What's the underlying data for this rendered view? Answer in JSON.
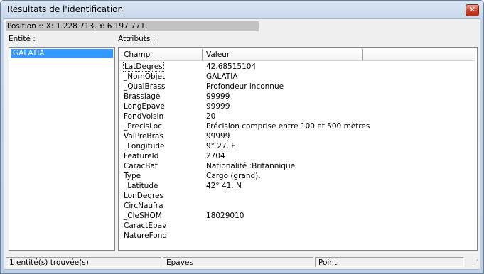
{
  "window": {
    "title": "Résultats de l'identification",
    "close_symbol": "✕"
  },
  "position": "Position :: X: 1 228 713,  Y: 6 197 771,",
  "labels": {
    "entite": "Entité :",
    "attributs": "Attributs :"
  },
  "entities": [
    "GALATIA"
  ],
  "table": {
    "columns": [
      "Champ",
      "Valeur",
      ""
    ],
    "rows": [
      {
        "field": "LatDegres",
        "value": "42.68515104"
      },
      {
        "field": "_NomObjet",
        "value": "GALATIA"
      },
      {
        "field": "_QualBrass",
        "value": "Profondeur inconnue"
      },
      {
        "field": "Brassiage",
        "value": "99999"
      },
      {
        "field": "LongEpave",
        "value": "99999"
      },
      {
        "field": "FondVoisin",
        "value": "20"
      },
      {
        "field": "_PrecisLoc",
        "value": "Précision comprise entre 100 et 500 mètres"
      },
      {
        "field": "ValPreBras",
        "value": "99999"
      },
      {
        "field": "_Longitude",
        "value": "9° 27.        E"
      },
      {
        "field": "FeatureId",
        "value": "2704"
      },
      {
        "field": "CaracBat",
        "value": "Nationalité :Britannique"
      },
      {
        "field": "Type",
        "value": "Cargo (grand)."
      },
      {
        "field": "_Latitude",
        "value": "42° 41.        N"
      },
      {
        "field": "LonDegres",
        "value": ""
      },
      {
        "field": "CircNaufra",
        "value": ""
      },
      {
        "field": "_CleSHOM",
        "value": "18029010"
      },
      {
        "field": "CaractEpav",
        "value": ""
      },
      {
        "field": "NatureFond",
        "value": ""
      }
    ]
  },
  "status": {
    "count": "1     entité(s) trouvée(s)",
    "layer": "Epaves",
    "geometry": "Point"
  }
}
